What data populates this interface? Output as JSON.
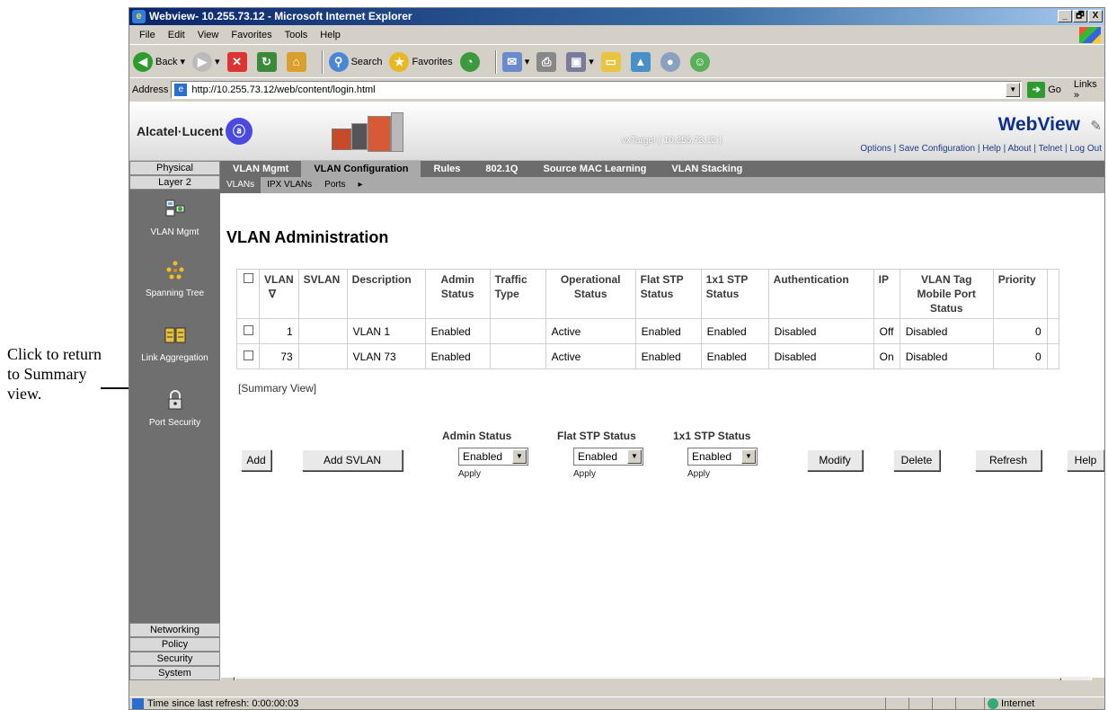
{
  "annotation": {
    "text": "Click to return to Summary view."
  },
  "window": {
    "title": "Webview- 10.255.73.12 - Microsoft Internet Explorer",
    "controls": [
      "_",
      "🗗",
      "X"
    ]
  },
  "menu": [
    "File",
    "Edit",
    "View",
    "Favorites",
    "Tools",
    "Help"
  ],
  "toolbar": {
    "back": "Back",
    "search": "Search",
    "favorites": "Favorites"
  },
  "address": {
    "label": "Address",
    "url": "http://10.255.73.12/web/content/login.html",
    "go": "Go",
    "links": "Links"
  },
  "banner": {
    "brand": "Alcatel·Lucent",
    "target": "vxTarget ( 10.255.73.12 )",
    "product": "WebView",
    "links": [
      "Options",
      "Save Configuration",
      "Help",
      "About",
      "Telnet",
      "Log Out"
    ]
  },
  "sidebar": {
    "physical": "Physical",
    "layer2": "Layer 2",
    "items": [
      "VLAN Mgmt",
      "Spanning Tree",
      "Link Aggregation",
      "Port Security"
    ],
    "networking": "Networking",
    "policy": "Policy",
    "security": "Security",
    "system": "System"
  },
  "nav": {
    "tabs": [
      "VLAN Mgmt",
      "VLAN Configuration",
      "Rules",
      "802.1Q",
      "Source MAC Learning",
      "VLAN Stacking"
    ],
    "active_tab": "VLAN Configuration",
    "subtabs": [
      "VLANs",
      "IPX VLANs",
      "Ports"
    ],
    "active_subtab": "VLANs"
  },
  "page": {
    "title": "VLAN Administration"
  },
  "table": {
    "headers": [
      "VLAN",
      "SVLAN",
      "Description",
      "Admin Status",
      "Traffic Type",
      "Operational Status",
      "Flat STP Status",
      "1x1 STP Status",
      "Authentication",
      "IP",
      "VLAN Tag Mobile Port Status",
      "Priority"
    ],
    "rows": [
      [
        "1",
        "",
        "VLAN 1",
        "Enabled",
        "",
        "Active",
        "Enabled",
        "Enabled",
        "Disabled",
        "Off",
        "Disabled",
        "0"
      ],
      [
        "73",
        "",
        "VLAN 73",
        "Enabled",
        "",
        "Active",
        "Enabled",
        "Enabled",
        "Disabled",
        "On",
        "Disabled",
        "0"
      ]
    ],
    "summary_link": "[Summary View]"
  },
  "controls": {
    "add": "Add",
    "add_svlan": "Add SVLAN",
    "admin_status": {
      "label": "Admin Status",
      "value": "Enabled",
      "apply": "Apply"
    },
    "flat_stp": {
      "label": "Flat STP Status",
      "value": "Enabled",
      "apply": "Apply"
    },
    "stp_1x1": {
      "label": "1x1 STP Status",
      "value": "Enabled",
      "apply": "Apply"
    },
    "modify": "Modify",
    "delete": "Delete",
    "refresh": "Refresh",
    "help": "Help"
  },
  "status": {
    "text": "Time since last refresh: 0:00:00:03",
    "zone": "Internet"
  }
}
